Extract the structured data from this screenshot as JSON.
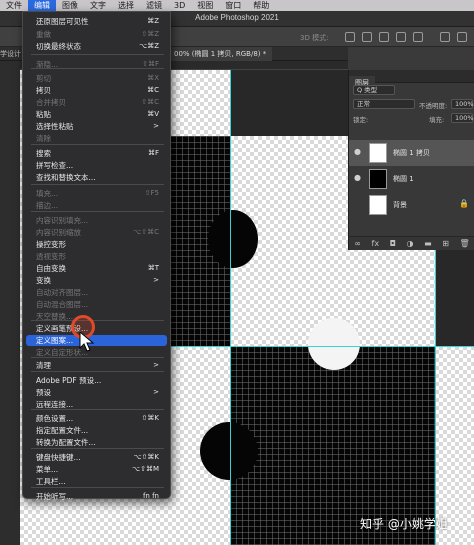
{
  "menubar": {
    "items": [
      "文件",
      "编辑",
      "图像",
      "文字",
      "选择",
      "滤镜",
      "3D",
      "视图",
      "窗口",
      "帮助"
    ],
    "active_index": 1
  },
  "titlebar": {
    "title": "Adobe Photoshop 2021"
  },
  "options_bar": {
    "mode_label": "3D 模式:"
  },
  "tabs": {
    "left_label": "学设计",
    "doc_label": "00% (椭圆 1 拷贝, RGB/8) *"
  },
  "edit_menu": {
    "items": [
      {
        "label": "还原图层可见性",
        "shortcut": "⌘Z",
        "disabled": false
      },
      {
        "label": "重做",
        "shortcut": "⇧⌘Z",
        "disabled": true
      },
      {
        "label": "切换最终状态",
        "shortcut": "⌥⌘Z",
        "disabled": false
      },
      {
        "label": "渐隐...",
        "shortcut": "⇧⌘F",
        "disabled": true
      },
      {
        "label": "剪切",
        "shortcut": "⌘X",
        "disabled": true
      },
      {
        "label": "拷贝",
        "shortcut": "⌘C",
        "disabled": false
      },
      {
        "label": "合并拷贝",
        "shortcut": "⇧⌘C",
        "disabled": true
      },
      {
        "label": "粘贴",
        "shortcut": "⌘V",
        "disabled": false
      },
      {
        "label": "选择性粘贴",
        "shortcut": ">",
        "disabled": false
      },
      {
        "label": "清除",
        "shortcut": "",
        "disabled": true
      },
      {
        "label": "搜索",
        "shortcut": "⌘F",
        "disabled": false
      },
      {
        "label": "拼写检查...",
        "shortcut": "",
        "disabled": false
      },
      {
        "label": "查找和替换文本...",
        "shortcut": "",
        "disabled": false
      },
      {
        "label": "填充...",
        "shortcut": "⇧F5",
        "disabled": true
      },
      {
        "label": "描边...",
        "shortcut": "",
        "disabled": true
      },
      {
        "label": "内容识别填充...",
        "shortcut": "",
        "disabled": true
      },
      {
        "label": "内容识别缩放",
        "shortcut": "⌥⇧⌘C",
        "disabled": true
      },
      {
        "label": "操控变形",
        "shortcut": "",
        "disabled": false
      },
      {
        "label": "透视变形",
        "shortcut": "",
        "disabled": true
      },
      {
        "label": "自由变换",
        "shortcut": "⌘T",
        "disabled": false
      },
      {
        "label": "变换",
        "shortcut": ">",
        "disabled": false
      },
      {
        "label": "自动对齐图层...",
        "shortcut": "",
        "disabled": true
      },
      {
        "label": "自动混合图层...",
        "shortcut": "",
        "disabled": true
      },
      {
        "label": "天空替换...",
        "shortcut": "",
        "disabled": true
      },
      {
        "label": "定义画笔预设...",
        "shortcut": "",
        "disabled": false
      },
      {
        "label": "定义图案...",
        "shortcut": "",
        "disabled": false,
        "highlighted": true
      },
      {
        "label": "定义自定形状...",
        "shortcut": "",
        "disabled": true
      },
      {
        "label": "清理",
        "shortcut": ">",
        "disabled": false
      },
      {
        "label": "Adobe PDF 预设...",
        "shortcut": "",
        "disabled": false
      },
      {
        "label": "预设",
        "shortcut": ">",
        "disabled": false
      },
      {
        "label": "远程连接...",
        "shortcut": "",
        "disabled": false
      },
      {
        "label": "颜色设置...",
        "shortcut": "⇧⌘K",
        "disabled": false
      },
      {
        "label": "指定配置文件...",
        "shortcut": "",
        "disabled": false
      },
      {
        "label": "转换为配置文件...",
        "shortcut": "",
        "disabled": false
      },
      {
        "label": "键盘快捷键...",
        "shortcut": "⌥⇧⌘K",
        "disabled": false
      },
      {
        "label": "菜单...",
        "shortcut": "⌥⇧⌘M",
        "disabled": false
      },
      {
        "label": "工具栏...",
        "shortcut": "",
        "disabled": false
      },
      {
        "label": "开始听写...",
        "shortcut": "fn fn",
        "disabled": false
      }
    ]
  },
  "layers_panel": {
    "tab": "图层",
    "filter": "Q 类型",
    "blend_mode": "正常",
    "opacity_label": "不透明度:",
    "opacity_value": "100%",
    "lock_label": "锁定:",
    "fill_label": "填充:",
    "fill_value": "100%",
    "layers": [
      {
        "name": "椭圆 1 拷贝",
        "active": true
      },
      {
        "name": "椭圆 1",
        "active": false
      },
      {
        "name": "背景",
        "active": false,
        "locked": true
      }
    ],
    "footer_icons": [
      "link-icon",
      "fx-icon",
      "mask-icon",
      "adjustment-icon",
      "folder-icon",
      "new-layer-icon",
      "trash-icon"
    ],
    "footer_glyphs": [
      "∞",
      "fx",
      "◘",
      "◑",
      "▬",
      "⊞",
      "🗑"
    ]
  },
  "watermark": "知乎 @小姚学姐"
}
